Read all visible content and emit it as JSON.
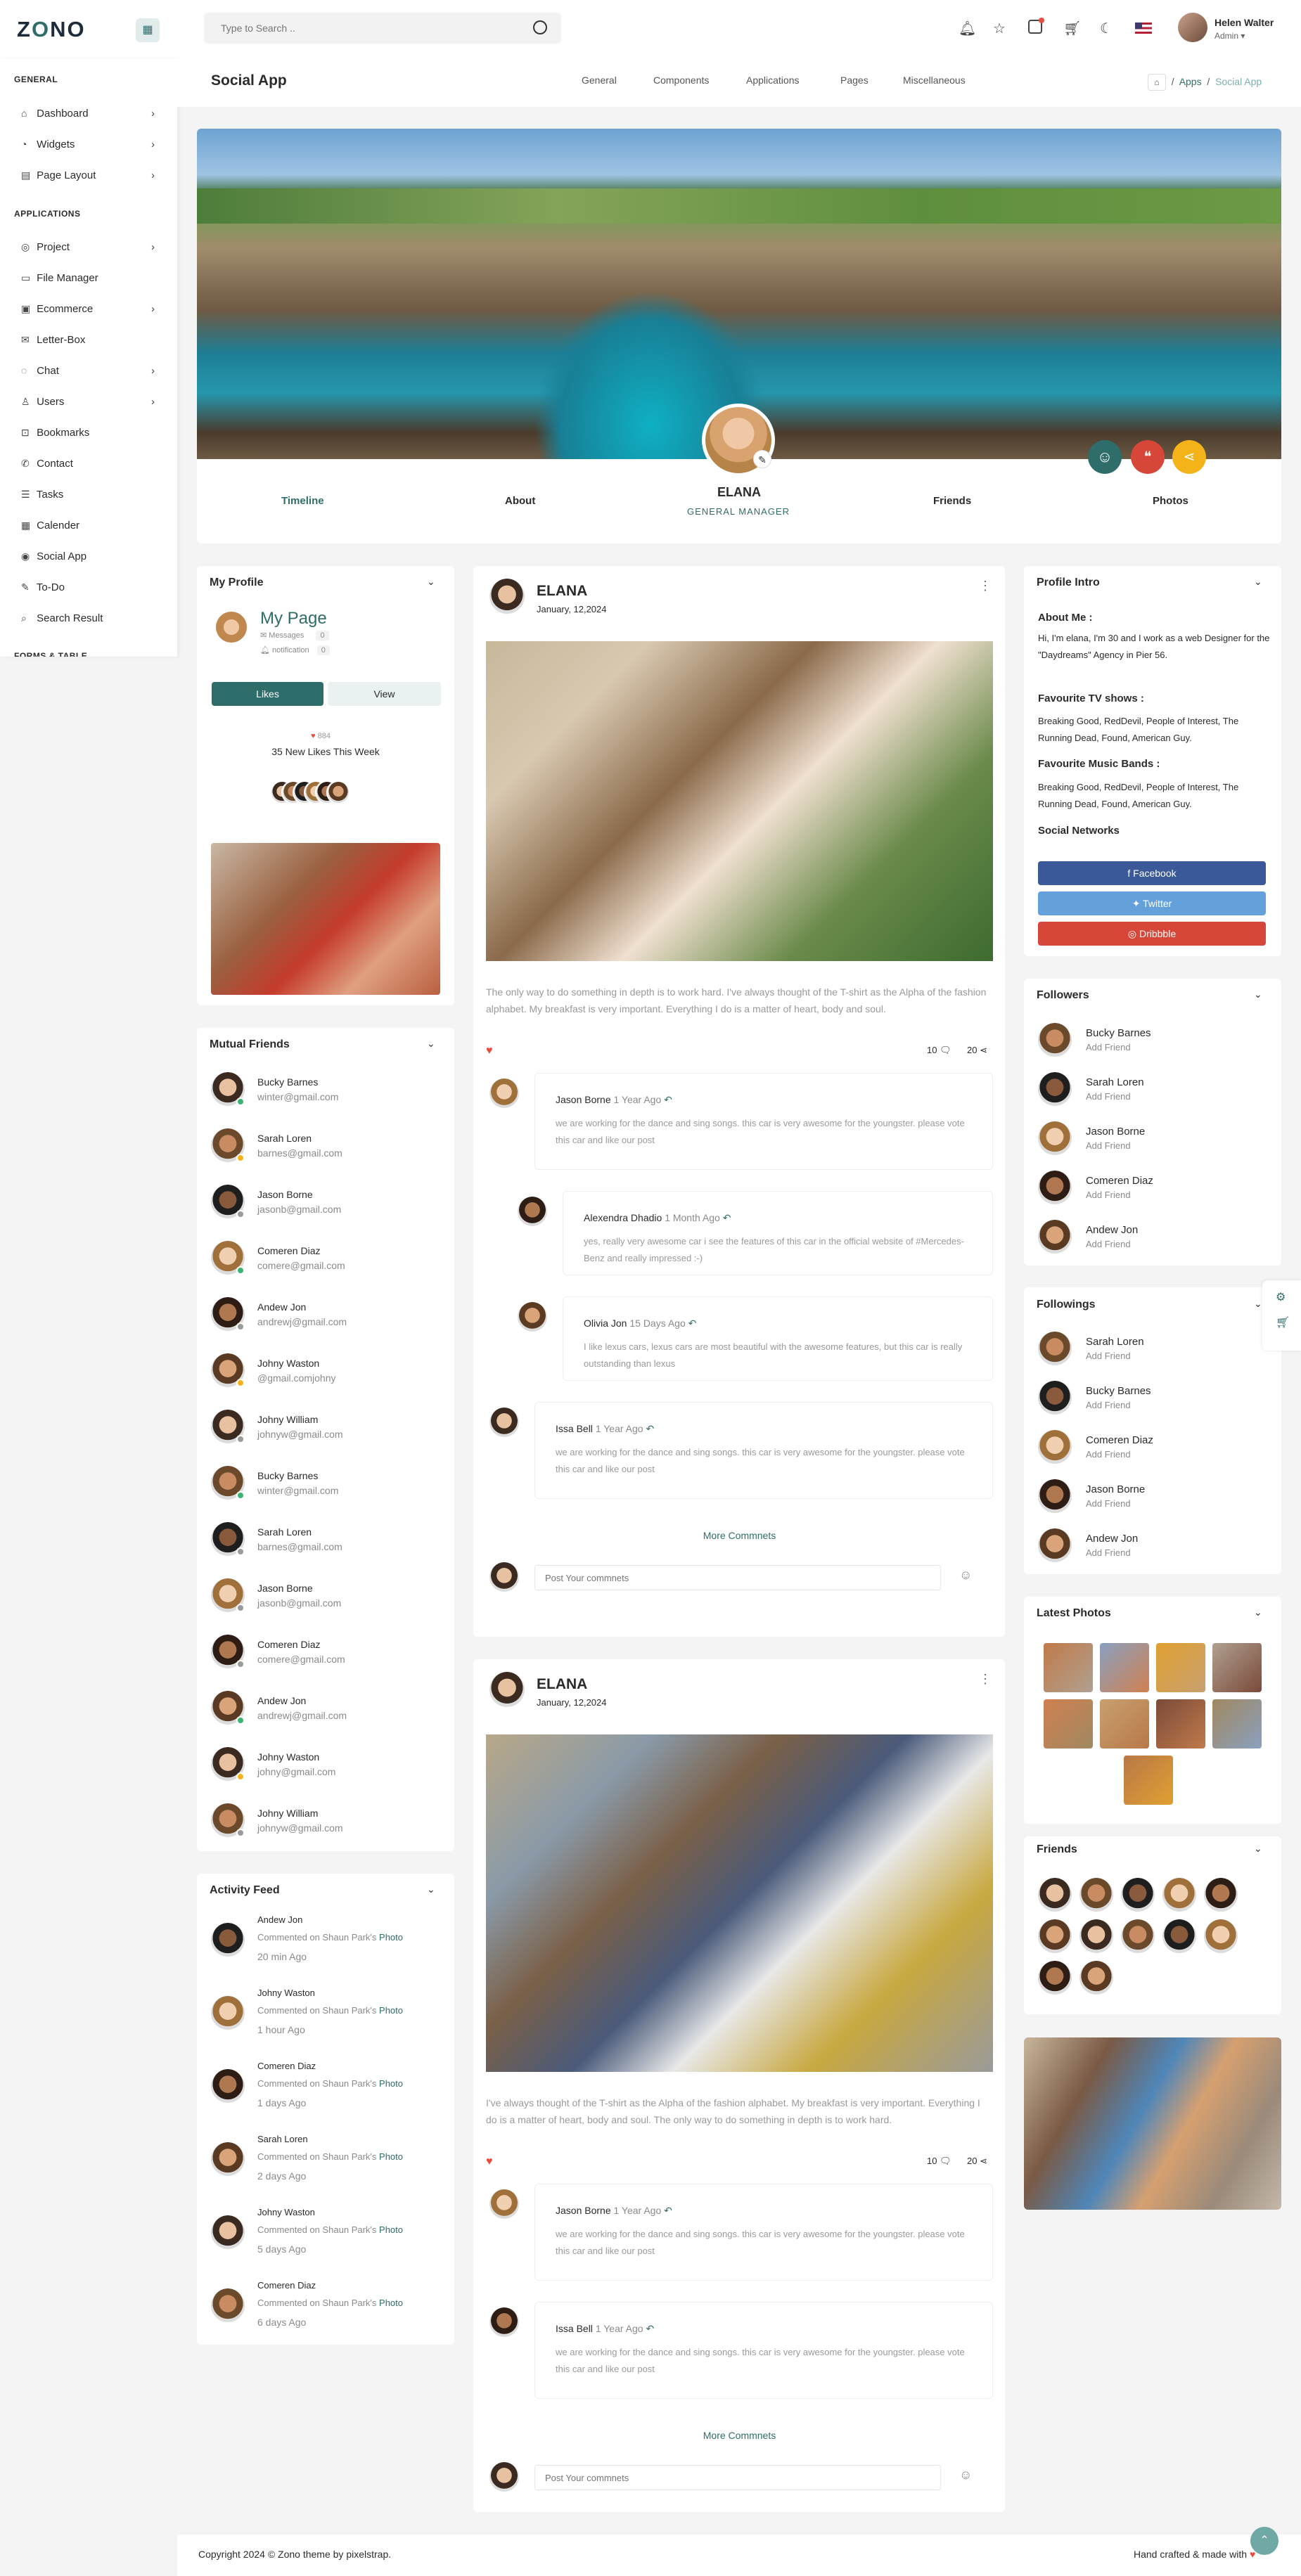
{
  "app": {
    "logo_main": "Z",
    "logo_accent": "O",
    "logo_rest": "NO"
  },
  "topbar": {
    "search_placeholder": "Type to Search ..",
    "user_name": "Helen Walter",
    "user_role": "Admin ▾",
    "icons": [
      "bell-icon",
      "star-icon",
      "message-icon",
      "cart-icon",
      "moon-icon",
      "flag-icon"
    ]
  },
  "sidebar": {
    "general_title": "GENERAL",
    "general": [
      {
        "label": "Dashboard",
        "icon": "⌂",
        "chev": "›"
      },
      {
        "label": "Widgets",
        "icon": "◔",
        "chev": "›"
      },
      {
        "label": "Page Layout",
        "icon": "▤",
        "chev": "›"
      }
    ],
    "applications_title": "APPLICATIONS",
    "applications": [
      {
        "label": "Project",
        "icon": "◎",
        "chev": "›"
      },
      {
        "label": "File Manager",
        "icon": "▭",
        "chev": ""
      },
      {
        "label": "Ecommerce",
        "icon": "▣",
        "chev": "›"
      },
      {
        "label": "Letter-Box",
        "icon": "✉",
        "chev": ""
      },
      {
        "label": "Chat",
        "icon": "◌",
        "chev": "›"
      },
      {
        "label": "Users",
        "icon": "♙",
        "chev": "›"
      },
      {
        "label": "Bookmarks",
        "icon": "⊡",
        "chev": ""
      },
      {
        "label": "Contact",
        "icon": "✆",
        "chev": ""
      },
      {
        "label": "Tasks",
        "icon": "☰",
        "chev": ""
      },
      {
        "label": "Calender",
        "icon": "▦",
        "chev": ""
      },
      {
        "label": "Social App",
        "icon": "◉",
        "chev": ""
      },
      {
        "label": "To-Do",
        "icon": "✎",
        "chev": ""
      },
      {
        "label": "Search Result",
        "icon": "⌕",
        "chev": ""
      }
    ],
    "forms_title": "FORMS & TABLE"
  },
  "header": {
    "title": "Social App",
    "menu": [
      "General",
      "Components",
      "Applications",
      "Pages",
      "Miscellaneous"
    ],
    "crumb_home": "⌂",
    "crumb_apps": "Apps",
    "crumb_sep": "/",
    "crumb_current": "Social App"
  },
  "profile": {
    "name": "ELANA",
    "role": "GENERAL MANAGER",
    "tabs": [
      "Timeline",
      "About",
      "Friends",
      "Photos"
    ]
  },
  "my_profile": {
    "title": "My Profile",
    "page": "My Page",
    "messages_label": "Messages",
    "messages_count": "0",
    "notification_label": "notification",
    "notification_count": "0",
    "likes_btn": "Likes",
    "view_btn": "View",
    "heart": "♥",
    "likes_count": "884",
    "likes_week": "35 New Likes This Week"
  },
  "mutual": {
    "title": "Mutual Friends",
    "items": [
      {
        "name": "Bucky Barnes",
        "email": "winter@gmail.com",
        "status": "#3cb371"
      },
      {
        "name": "Sarah Loren",
        "email": "barnes@gmail.com",
        "status": "#f5b31a"
      },
      {
        "name": "Jason Borne",
        "email": "jasonb@gmail.com",
        "status": "#9a9a9a"
      },
      {
        "name": "Comeren Diaz",
        "email": "comere@gmail.com",
        "status": "#3cb371"
      },
      {
        "name": "Andew Jon",
        "email": "andrewj@gmail.com",
        "status": "#9a9a9a"
      },
      {
        "name": "Johny Waston",
        "email": "@gmail.comjohny",
        "status": "#f5b31a"
      },
      {
        "name": "Johny William",
        "email": "johnyw@gmail.com",
        "status": "#9a9a9a"
      },
      {
        "name": "Bucky Barnes",
        "email": "winter@gmail.com",
        "status": "#3cb371"
      },
      {
        "name": "Sarah Loren",
        "email": "barnes@gmail.com",
        "status": "#9a9a9a"
      },
      {
        "name": "Jason Borne",
        "email": "jasonb@gmail.com",
        "status": "#9a9a9a"
      },
      {
        "name": "Comeren Diaz",
        "email": "comere@gmail.com",
        "status": "#9a9a9a"
      },
      {
        "name": "Andew Jon",
        "email": "andrewj@gmail.com",
        "status": "#3cb371"
      },
      {
        "name": "Johny Waston",
        "email": "johny@gmail.com",
        "status": "#f5b31a"
      },
      {
        "name": "Johny William",
        "email": "johnyw@gmail.com",
        "status": "#9a9a9a"
      }
    ]
  },
  "activity": {
    "title": "Activity Feed",
    "items": [
      {
        "name": "Andew Jon",
        "text": "Commented on Shaun Park's",
        "link": "Photo",
        "time": "20 min Ago"
      },
      {
        "name": "Johny Waston",
        "text": "Commented on Shaun Park's",
        "link": "Photo",
        "time": "1 hour Ago"
      },
      {
        "name": "Comeren Diaz",
        "text": "Commented on Shaun Park's",
        "link": "Photo",
        "time": "1 days Ago"
      },
      {
        "name": "Sarah Loren",
        "text": "Commented on Shaun Park's",
        "link": "Photo",
        "time": "2 days Ago"
      },
      {
        "name": "Johny Waston",
        "text": "Commented on Shaun Park's",
        "link": "Photo",
        "time": "5 days Ago"
      },
      {
        "name": "Comeren Diaz",
        "text": "Commented on Shaun Park's",
        "link": "Photo",
        "time": "6 days Ago"
      }
    ]
  },
  "posts": [
    {
      "author": "ELANA",
      "date": "January, 12,2024",
      "text": "The only way to do something in depth is to work hard. I've always thought of the T-shirt as the Alpha of the fashion alphabet. My breakfast is very important. Everything I do is a matter of heart, body and soul.",
      "comments_count": "10",
      "shares_count": "20",
      "comments": [
        {
          "name": "Jason Borne",
          "time": "1 Year Ago",
          "text": "we are working for the dance and sing songs. this car is very awesome for the youngster. please vote this car and like our post"
        },
        {
          "name": "Alexendra Dhadio",
          "time": "1 Month Ago",
          "text": "yes, really very awesome car i see the features of this car in the official website of #Mercedes-Benz and really impressed :-)"
        },
        {
          "name": "Olivia Jon",
          "time": "15 Days Ago",
          "text": "I like lexus cars, lexus cars are most beautiful with the awesome features, but this car is really outstanding than lexus"
        },
        {
          "name": "Issa Bell",
          "time": "1 Year Ago",
          "text": "we are working for the dance and sing songs. this car is very awesome for the youngster. please vote this car and like our post"
        }
      ],
      "more": "More Commnets",
      "placeholder": "Post Your commnets"
    },
    {
      "author": "ELANA",
      "date": "January, 12,2024",
      "text": "I've always thought of the T-shirt as the Alpha of the fashion alphabet. My breakfast is very important. Everything I do is a matter of heart, body and soul. The only way to do something in depth is to work hard.",
      "comments_count": "10",
      "shares_count": "20",
      "comments": [
        {
          "name": "Jason Borne",
          "time": "1 Year Ago",
          "text": "we are working for the dance and sing songs. this car is very awesome for the youngster. please vote this car and like our post"
        },
        {
          "name": "Issa Bell",
          "time": "1 Year Ago",
          "text": "we are working for the dance and sing songs. this car is very awesome for the youngster. please vote this car and like our post"
        }
      ],
      "more": "More Commnets",
      "placeholder": "Post Your commnets"
    }
  ],
  "intro": {
    "title": "Profile Intro",
    "about_h": "About Me :",
    "about": "Hi, I'm elana, I'm 30 and I work as a web Designer for the \"Daydreams\" Agency in Pier 56.",
    "tv_h": "Favourite TV shows :",
    "tv": "Breaking Good, RedDevil, People of Interest, The Running Dead, Found, American Guy.",
    "music_h": "Favourite Music Bands :",
    "music": "Breaking Good, RedDevil, People of Interest, The Running Dead, Found, American Guy.",
    "social_h": "Social Networks",
    "facebook": "f Facebook",
    "twitter": "✦ Twitter",
    "dribbble": "◎ Dribbble"
  },
  "followers": {
    "title": "Followers",
    "add": "Add Friend",
    "items": [
      "Bucky Barnes",
      "Sarah Loren",
      "Jason Borne",
      "Comeren Diaz",
      "Andew Jon"
    ]
  },
  "followings": {
    "title": "Followings",
    "add": "Add Friend",
    "items": [
      "Sarah Loren",
      "Bucky Barnes",
      "Comeren Diaz",
      "Jason Borne",
      "Andew Jon"
    ]
  },
  "latest_photos": {
    "title": "Latest Photos"
  },
  "friends": {
    "title": "Friends"
  },
  "footer": {
    "copyright": "Copyright 2024 © Zono theme by pixelstrap.",
    "made": "Hand crafted & made with",
    "heart": "♥"
  },
  "colors": {
    "accent": "#2f6d6a",
    "facebook": "#3b5998",
    "twitter": "#64a1db",
    "dribbble": "#d6473a"
  }
}
